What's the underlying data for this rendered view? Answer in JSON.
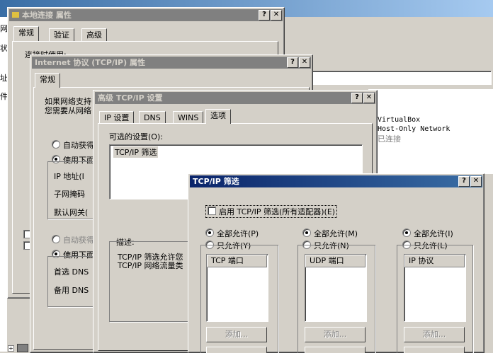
{
  "background": {
    "address_bar_fragment": "",
    "side_fragments": [
      "网",
      "状",
      "址",
      "件"
    ],
    "adapter_name": "VirtualBox",
    "adapter_type": "Host-Only Network",
    "adapter_status": "已连接"
  },
  "local_conn": {
    "title": "本地连接 属性",
    "tabs": [
      "常规",
      "验证",
      "高级"
    ],
    "connect_using_label": "连接时使用:"
  },
  "ipv4": {
    "title": "Internet 协议 (TCP/IP) 属性",
    "tab": "常规",
    "intro_line1": "如果网络支持",
    "intro_line2": "您需要从网络",
    "auto_ip": "自动获得",
    "manual_ip": "使用下面",
    "ip_label": "IP 地址(I",
    "mask_label": "子网掩码",
    "gateway_label": "默认网关(",
    "auto_dns": "自动获得",
    "manual_dns": "使用下面",
    "pref_dns": "首选 DNS",
    "alt_dns": "备用 DNS"
  },
  "advanced": {
    "title": "高级 TCP/IP 设置",
    "tabs": [
      "IP 设置",
      "DNS",
      "WINS",
      "选项"
    ],
    "optional_label": "可选的设置(O):",
    "optional_items": [
      "TCP/IP 筛选"
    ],
    "desc_label": "描述:",
    "desc_line1": "TCP/IP 筛选允许您",
    "desc_line2": "TCP/IP 网络流量类"
  },
  "filter": {
    "title": "TCP/IP 筛选",
    "enable_label": "启用 TCP/IP 筛选(所有适配器)(E)",
    "columns": [
      {
        "allow_all": "全部允许(P)",
        "allow_only": "只允许(Y)",
        "header": "TCP 端口",
        "add": "添加..."
      },
      {
        "allow_all": "全部允许(M)",
        "allow_only": "只允许(N)",
        "header": "UDP 端口",
        "add": "添加..."
      },
      {
        "allow_all": "全部允许(I)",
        "allow_only": "只允许(L)",
        "header": "IP 协议",
        "add": "添加..."
      }
    ]
  },
  "titlebar_buttons": {
    "help": "?",
    "close": "✕"
  }
}
